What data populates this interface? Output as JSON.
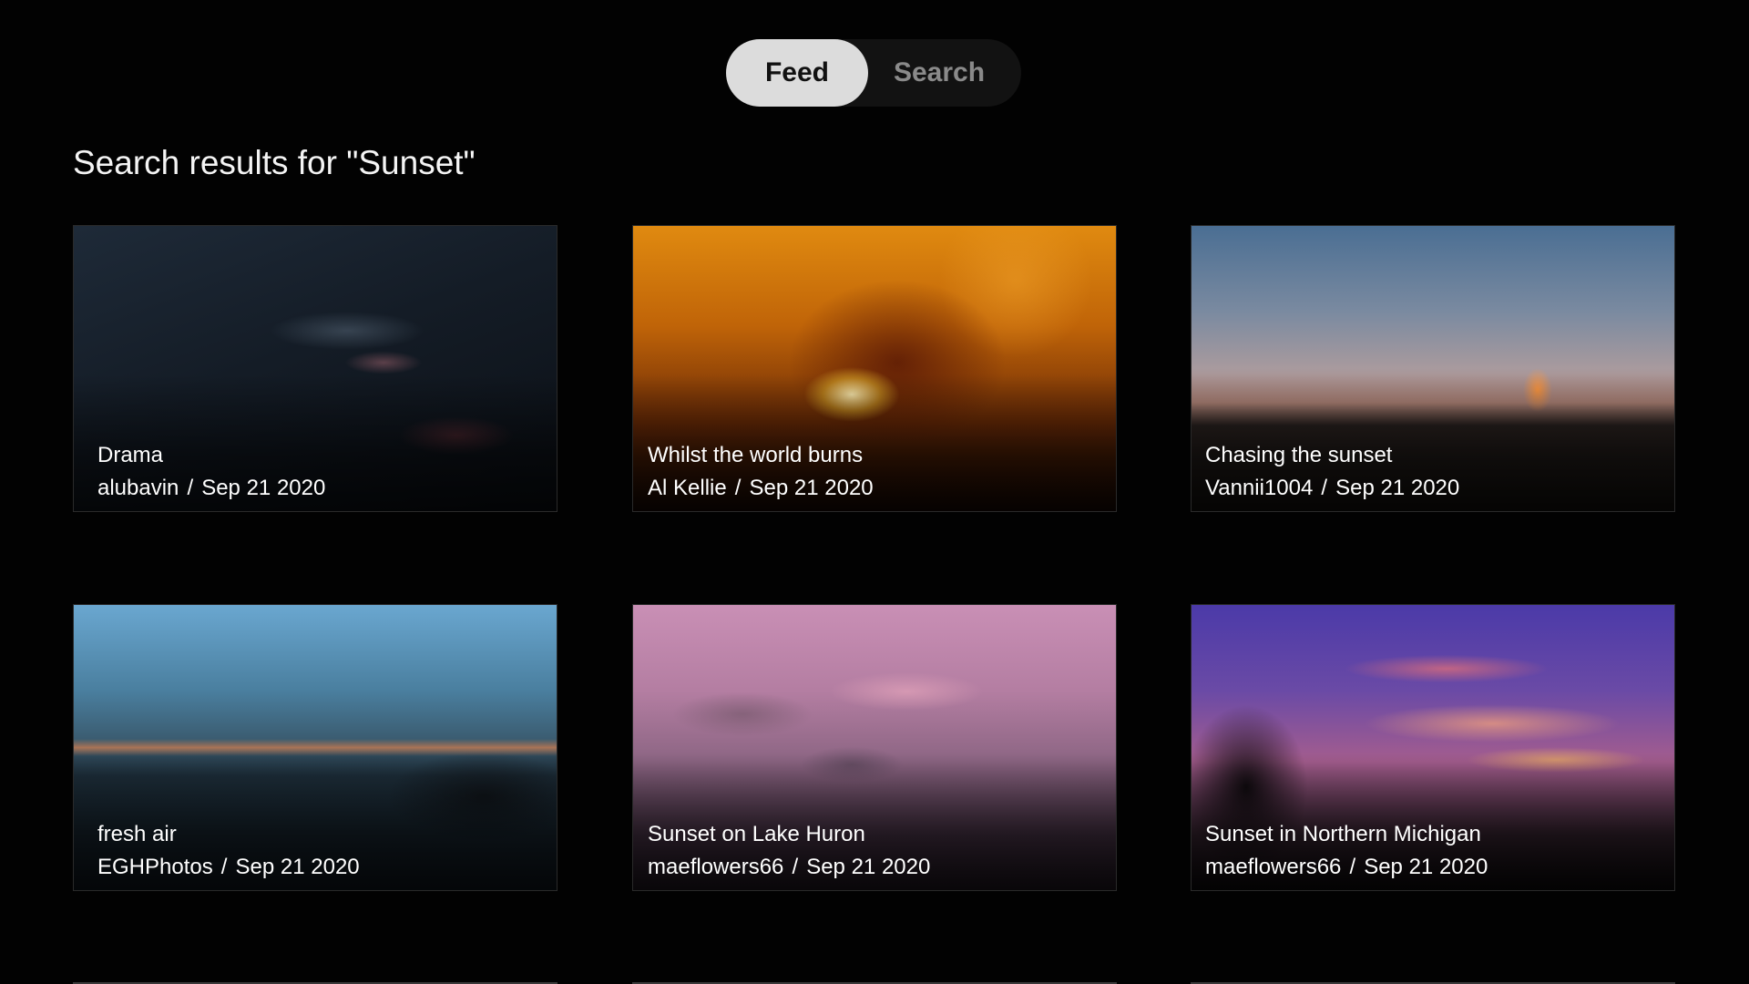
{
  "nav": {
    "tabs": [
      {
        "label": "Feed",
        "selected": true
      },
      {
        "label": "Search",
        "selected": false
      }
    ]
  },
  "results": {
    "heading": "Search results for \"Sunset\"",
    "items": [
      {
        "title": "Drama",
        "author": "alubavin",
        "date": "Sep 21 2020"
      },
      {
        "title": "Whilst the world burns",
        "author": "Al Kellie",
        "date": "Sep 21 2020"
      },
      {
        "title": "Chasing the sunset",
        "author": "Vannii1004",
        "date": "Sep 21 2020"
      },
      {
        "title": "fresh air",
        "author": "EGHPhotos",
        "date": "Sep 21 2020"
      },
      {
        "title": "Sunset on Lake Huron",
        "author": "maeflowers66",
        "date": "Sep 21 2020"
      },
      {
        "title": "Sunset in Northern Michigan",
        "author": "maeflowers66",
        "date": "Sep 21 2020"
      }
    ]
  },
  "colors": {
    "background": "#020202",
    "segment_selected": "#dcdcdc",
    "segment_track": "#121212",
    "segment_unselected_text": "#8a8a8a"
  }
}
